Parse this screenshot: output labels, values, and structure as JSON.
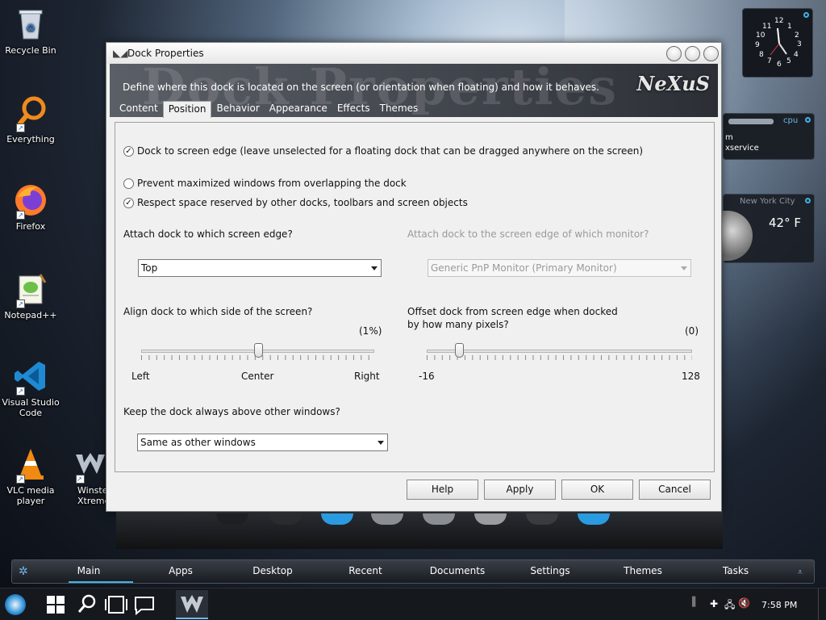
{
  "desktop": {
    "icons": [
      {
        "label": "Recycle Bin"
      },
      {
        "label": "Everything"
      },
      {
        "label": "Firefox"
      },
      {
        "label": "Notepad++"
      },
      {
        "label": "Visual Studio Code"
      },
      {
        "label": "VLC media player"
      },
      {
        "label": "Winstep Xtreme"
      }
    ]
  },
  "widgets": {
    "clock_numbers": [
      "12",
      "1",
      "2",
      "3",
      "4",
      "5",
      "6",
      "7",
      "8",
      "9",
      "10",
      "11"
    ],
    "cpu": {
      "title": "cpu",
      "line1": "m",
      "line2": "xservice"
    },
    "weather": {
      "city": "New York City",
      "temp": "42° F"
    }
  },
  "dialog": {
    "title": "Dock Properties",
    "banner_watermark": "Dock Properties",
    "banner_description": "Define where this dock is located on the screen (or orientation when floating) and how it behaves.",
    "logo": "NeXuS",
    "tabs": [
      "Content",
      "Position",
      "Behavior",
      "Appearance",
      "Effects",
      "Themes"
    ],
    "active_tab": "Position",
    "options": {
      "dock_to_edge": {
        "label": "Dock to screen edge (leave unselected for a floating dock that can be dragged anywhere on the screen)",
        "checked": true
      },
      "prevent_maximized": {
        "label": "Prevent maximized windows from overlapping the dock",
        "checked": false
      },
      "respect_space": {
        "label": "Respect space reserved by other docks, toolbars and screen objects",
        "checked": true
      }
    },
    "attach_edge": {
      "label": "Attach dock to which screen edge?",
      "value": "Top"
    },
    "attach_monitor": {
      "label": "Attach dock to the screen edge of which monitor?",
      "value": "Generic PnP Monitor (Primary Monitor)"
    },
    "align": {
      "label": "Align dock to which side of the screen?",
      "value_text": "(1%)",
      "value_percent": 1,
      "left": "Left",
      "center": "Center",
      "right": "Right"
    },
    "offset": {
      "label_line1": "Offset dock from screen edge when docked",
      "label_line2": "by how many pixels?",
      "value_text": "(0)",
      "value": 0,
      "min": "-16",
      "max": "128"
    },
    "always_above": {
      "label": "Keep the dock always above other windows?",
      "value": "Same as other windows"
    },
    "buttons": {
      "help": "Help",
      "apply": "Apply",
      "ok": "OK",
      "cancel": "Cancel"
    }
  },
  "dockbar": {
    "tabs": [
      "Main",
      "Apps",
      "Desktop",
      "Recent",
      "Documents",
      "Settings",
      "Themes",
      "Tasks"
    ],
    "active": "Main"
  },
  "taskbar": {
    "time": "7:58 PM"
  }
}
